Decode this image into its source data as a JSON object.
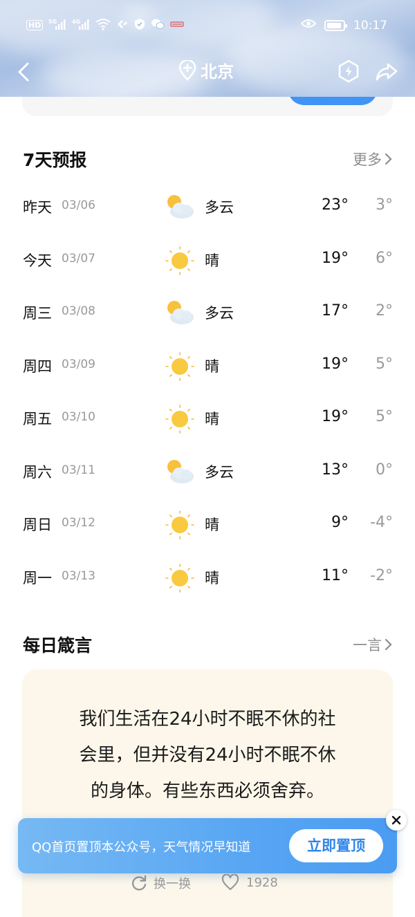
{
  "status_bar": {
    "time": "10:17",
    "network_left": "HD",
    "sig1": "5G",
    "sig2": "4G"
  },
  "nav": {
    "city": "北京"
  },
  "forecast": {
    "title": "7天预报",
    "more_label": "更多",
    "days": [
      {
        "day": "昨天",
        "date": "03/06",
        "weather": "多云",
        "icon": "partly-cloudy-icon",
        "high": "23°",
        "low": "3°"
      },
      {
        "day": "今天",
        "date": "03/07",
        "weather": "晴",
        "icon": "sunny-icon",
        "high": "19°",
        "low": "6°"
      },
      {
        "day": "周三",
        "date": "03/08",
        "weather": "多云",
        "icon": "partly-cloudy-icon",
        "high": "17°",
        "low": "2°"
      },
      {
        "day": "周四",
        "date": "03/09",
        "weather": "晴",
        "icon": "sunny-icon",
        "high": "19°",
        "low": "5°"
      },
      {
        "day": "周五",
        "date": "03/10",
        "weather": "晴",
        "icon": "sunny-icon",
        "high": "19°",
        "low": "5°"
      },
      {
        "day": "周六",
        "date": "03/11",
        "weather": "多云",
        "icon": "partly-cloudy-icon",
        "high": "13°",
        "low": "0°"
      },
      {
        "day": "周日",
        "date": "03/12",
        "weather": "晴",
        "icon": "sunny-icon",
        "high": "9°",
        "low": "-4°"
      },
      {
        "day": "周一",
        "date": "03/13",
        "weather": "晴",
        "icon": "sunny-icon",
        "high": "11°",
        "low": "-2°"
      }
    ]
  },
  "quote": {
    "title": "每日箴言",
    "more_label": "一言",
    "text": "我们生活在24小时不眠不休的社会里，但并没有24小时不眠不休的身体。有些东西必须舍弃。",
    "refresh_label": "换一换",
    "like_count": "1928"
  },
  "banner": {
    "text": "QQ首页置顶本公众号，天气情况早知道",
    "button_label": "立即置顶"
  },
  "colors": {
    "accent": "#3f94f5",
    "banner": "#58a6f3",
    "card": "#fcf7ea"
  }
}
